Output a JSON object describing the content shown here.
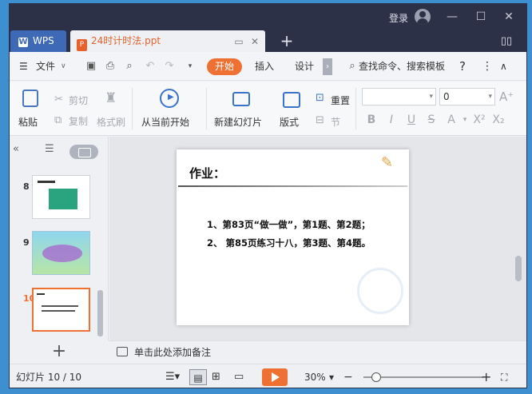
{
  "titlebar": {
    "login_label": "登录",
    "minimize": "—",
    "maximize": "☐",
    "close": "✕"
  },
  "tabs": {
    "wps_label": "WPS",
    "doc_label": "24时计时法.ppt",
    "add": "+"
  },
  "menu": {
    "file_label": "文件",
    "start_label": "开始",
    "insert_label": "插入",
    "design_label": "设计",
    "more_arrow": "›",
    "search_label": "查找命令、搜索模板",
    "help": "?",
    "more": "⋮",
    "collapse": "∧"
  },
  "ribbon": {
    "paste_label": "粘贴",
    "cut_label": "剪切",
    "copy_label": "复制",
    "format_painter_label": "格式刷",
    "play_from_current_label": "从当前开始",
    "new_slide_label": "新建幻灯片",
    "layout_label": "版式",
    "reset_label": "重置",
    "section_label": "节",
    "font_size_value": "0",
    "font_name_value": ""
  },
  "slides_panel": {
    "thumbnails": [
      {
        "number": "8"
      },
      {
        "number": "9"
      },
      {
        "number": "10",
        "selected": true
      }
    ],
    "add_button": "+"
  },
  "slide": {
    "title": "作业：",
    "lines": [
      "1、第83页“做一做”，第1题、第2题；",
      "2、 第85页练习十八，第3题、第4题。"
    ]
  },
  "notes": {
    "placeholder": "单击此处添加备注"
  },
  "status": {
    "slide_counter": "幻灯片 10 / 10",
    "zoom_level": "30%",
    "zoom_minus": "−",
    "zoom_plus": "+",
    "zoom_fraction": 0.3
  },
  "colors": {
    "accent": "#ee7133",
    "titlebar": "#2c3148",
    "wps_tab": "#3e69b7"
  }
}
